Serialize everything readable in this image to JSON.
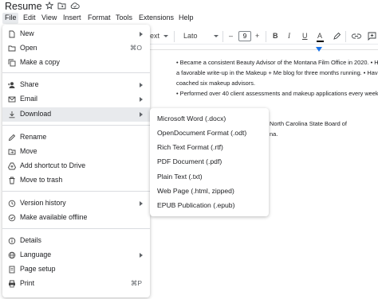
{
  "document": {
    "title": "Resume",
    "lines": [
      "• Became a consistent Beauty Advisor of the Montana Film Office in 2020. • Have",
      "a favorable write-up in the Makeup + Me blog for three months running. • Have",
      "coached six makeup advisors.",
      "• Performed over 40 client assessments and makeup applications every week.",
      "North Carolina State Board of",
      "na."
    ]
  },
  "menubar": [
    "File",
    "Edit",
    "View",
    "Insert",
    "Format",
    "Tools",
    "Extensions",
    "Help"
  ],
  "toolbar": {
    "style_fragment": "ext",
    "font": "Lato",
    "minus": "–",
    "size": "9",
    "plus": "+",
    "bold": "B",
    "italic": "I",
    "underline": "U",
    "color": "A"
  },
  "file_menu": {
    "items": [
      {
        "label": "New",
        "icon": "new-doc-icon",
        "submenu": true
      },
      {
        "label": "Open",
        "icon": "folder-icon",
        "shortcut": "⌘O"
      },
      {
        "label": "Make a copy",
        "icon": "copy-icon"
      },
      {
        "label": "Share",
        "icon": "share-person-icon",
        "submenu": true
      },
      {
        "label": "Email",
        "icon": "email-icon",
        "submenu": true
      },
      {
        "label": "Download",
        "icon": "download-icon",
        "submenu": true,
        "active": true
      },
      {
        "label": "Rename",
        "icon": "rename-icon"
      },
      {
        "label": "Move",
        "icon": "move-folder-icon"
      },
      {
        "label": "Add shortcut to Drive",
        "icon": "drive-shortcut-icon"
      },
      {
        "label": "Move to trash",
        "icon": "trash-icon"
      },
      {
        "label": "Version history",
        "icon": "history-icon",
        "submenu": true
      },
      {
        "label": "Make available offline",
        "icon": "offline-icon"
      },
      {
        "label": "Details",
        "icon": "info-icon"
      },
      {
        "label": "Language",
        "icon": "globe-icon",
        "submenu": true
      },
      {
        "label": "Page setup",
        "icon": "page-setup-icon"
      },
      {
        "label": "Print",
        "icon": "print-icon",
        "shortcut": "⌘P"
      }
    ]
  },
  "download_menu": {
    "items": [
      "Microsoft Word (.docx)",
      "OpenDocument Format (.odt)",
      "Rich Text Format (.rtf)",
      "PDF Document (.pdf)",
      "Plain Text (.txt)",
      "Web Page (.html, zipped)",
      "EPUB Publication (.epub)"
    ]
  },
  "colors": {
    "active_bg": "#e8eaed",
    "accent_blue": "#1a73e8"
  }
}
